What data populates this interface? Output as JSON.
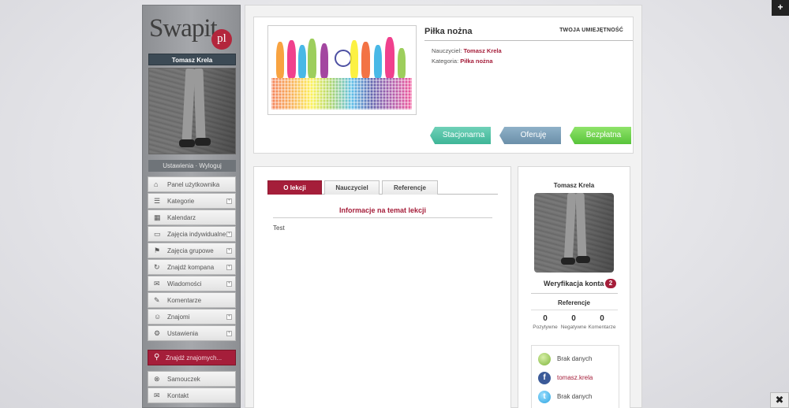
{
  "brand": {
    "logo_text": "Swapit",
    "logo_suffix": "pl"
  },
  "sidebar": {
    "username": "Tomasz Krela",
    "settings_logout": "Ustawienia · Wyloguj",
    "menu": [
      {
        "label": "Panel użytkownika",
        "icon": "home-icon",
        "glyph": "⌂",
        "expandable": false
      },
      {
        "label": "Kategorie",
        "icon": "list-icon",
        "glyph": "☰",
        "expandable": true
      },
      {
        "label": "Kalendarz",
        "icon": "calendar-icon",
        "glyph": "▦",
        "expandable": false
      },
      {
        "label": "Zajęcia indywidualne",
        "icon": "presentation-icon",
        "glyph": "▭",
        "expandable": true
      },
      {
        "label": "Zajęcia grupowe",
        "icon": "signpost-icon",
        "glyph": "⚑",
        "expandable": true
      },
      {
        "label": "Znajdź kompana",
        "icon": "refresh-icon",
        "glyph": "↻",
        "expandable": true
      },
      {
        "label": "Wiadomości",
        "icon": "envelope-icon",
        "glyph": "✉",
        "expandable": true
      },
      {
        "label": "Komentarze",
        "icon": "comment-icon",
        "glyph": "✎",
        "expandable": false
      },
      {
        "label": "Znajomi",
        "icon": "users-icon",
        "glyph": "☺",
        "expandable": true
      },
      {
        "label": "Ustawienia",
        "icon": "gear-icon",
        "glyph": "⚙",
        "expandable": true
      }
    ],
    "search_placeholder": "Znajdź znajomych...",
    "menu_bottom": [
      {
        "label": "Samouczek",
        "icon": "lifebuoy-icon",
        "glyph": "⊗"
      },
      {
        "label": "Kontakt",
        "icon": "envelope-icon",
        "glyph": "✉"
      }
    ]
  },
  "skill": {
    "title": "Piłka nożna",
    "badge": "TWOJA UMIEJĘTNOŚĆ",
    "teacher_label": "Nauczyciel:",
    "teacher_value": "Tomasz Krela",
    "category_label": "Kategoria:",
    "category_value": "Piłka nożna",
    "ribbons": [
      "Stacjonarna",
      "Oferuję",
      "Bezpłatna"
    ],
    "ribbon_colors": [
      "#3eb597",
      "#6b8fa9",
      "#58c43a"
    ]
  },
  "tabs": [
    "O lekcji",
    "Nauczyciel",
    "Referencje"
  ],
  "lesson": {
    "info_title": "Informacje na temat lekcji",
    "text": "Test"
  },
  "profile": {
    "name": "Tomasz Krela",
    "verification_label": "Weryfikacja konta",
    "verification_count": "2",
    "references_title": "Referencje",
    "references": [
      {
        "count": "0",
        "label": "Pozytywne"
      },
      {
        "count": "0",
        "label": "Negatywne"
      },
      {
        "count": "0",
        "label": "Komentarze"
      }
    ],
    "social": [
      {
        "icon": "contact-icon",
        "glyph": "",
        "text": "Brak danych"
      },
      {
        "icon": "facebook-icon",
        "glyph": "f",
        "text": "tomasz.krela"
      },
      {
        "icon": "twitter-icon",
        "glyph": "t",
        "text": "Brak danych"
      },
      {
        "icon": "other-social-icon",
        "glyph": "",
        "text": ""
      }
    ]
  },
  "corner": {
    "plus": "+",
    "tools": "✖"
  },
  "colors": {
    "accent": "#a51e3a",
    "sidebar_dark": "#3c4a55"
  }
}
